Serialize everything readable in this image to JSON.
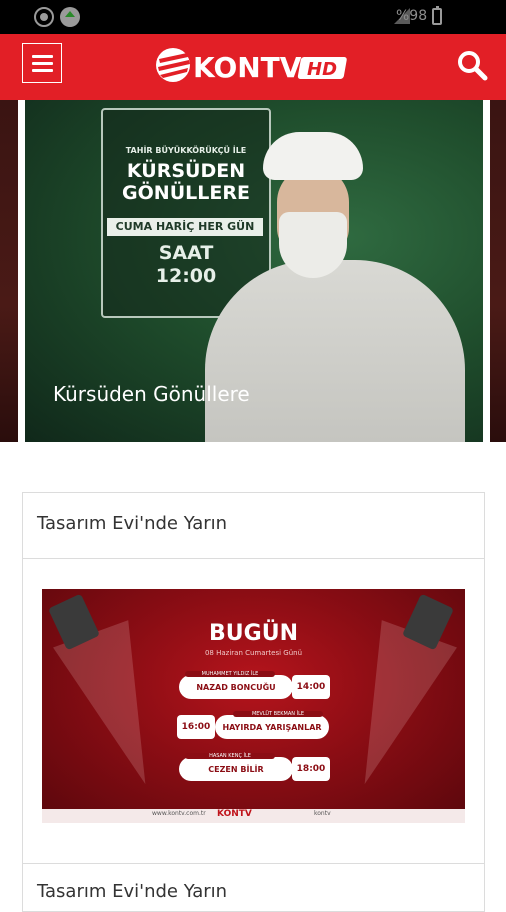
{
  "status_bar": {
    "battery_text": "%98"
  },
  "header": {
    "logo_text": "KONTV",
    "logo_badge": "HD"
  },
  "carousel": {
    "slide": {
      "caption": "Kürsüden Gönüllere",
      "board_small": "TAHİR BÜYÜKKÖRÜKÇÜ İLE",
      "board_title": "KÜRSÜDEN\nGÖNÜLLERE",
      "board_strip": "CUMA HARİÇ HER GÜN",
      "board_saat": "SAAT\n12:00"
    }
  },
  "card": {
    "title": "Tasarım Evi'nde Yarın",
    "banner": {
      "title": "BUGÜN",
      "subtitle": "08 Haziran Cumartesi Günü",
      "rows": [
        {
          "host": "MUHAMMET YILDIZ İLE",
          "name": "NAZAD BONCUĞU",
          "time": "14:00"
        },
        {
          "host": "MEVLÜT BEKMAN İLE",
          "name": "HAYIRDA YARIŞANLAR",
          "time": "16:00"
        },
        {
          "host": "HASAN KENÇ İLE",
          "name": "CEZEN BİLİR",
          "time": "18:00"
        }
      ],
      "footer_left": "www.kontv.com.tr",
      "footer_logo": "KONTV",
      "footer_right": "kontv"
    },
    "next_title": "Tasarım Evi'nde Yarın"
  },
  "colors": {
    "brand_red": "#e21f26",
    "banner_red": "#8b0d14"
  },
  "icons": [
    "menu-icon",
    "search-icon",
    "kontv-logo",
    "notification-icon",
    "home-icon",
    "signal-icon",
    "battery-icon"
  ]
}
